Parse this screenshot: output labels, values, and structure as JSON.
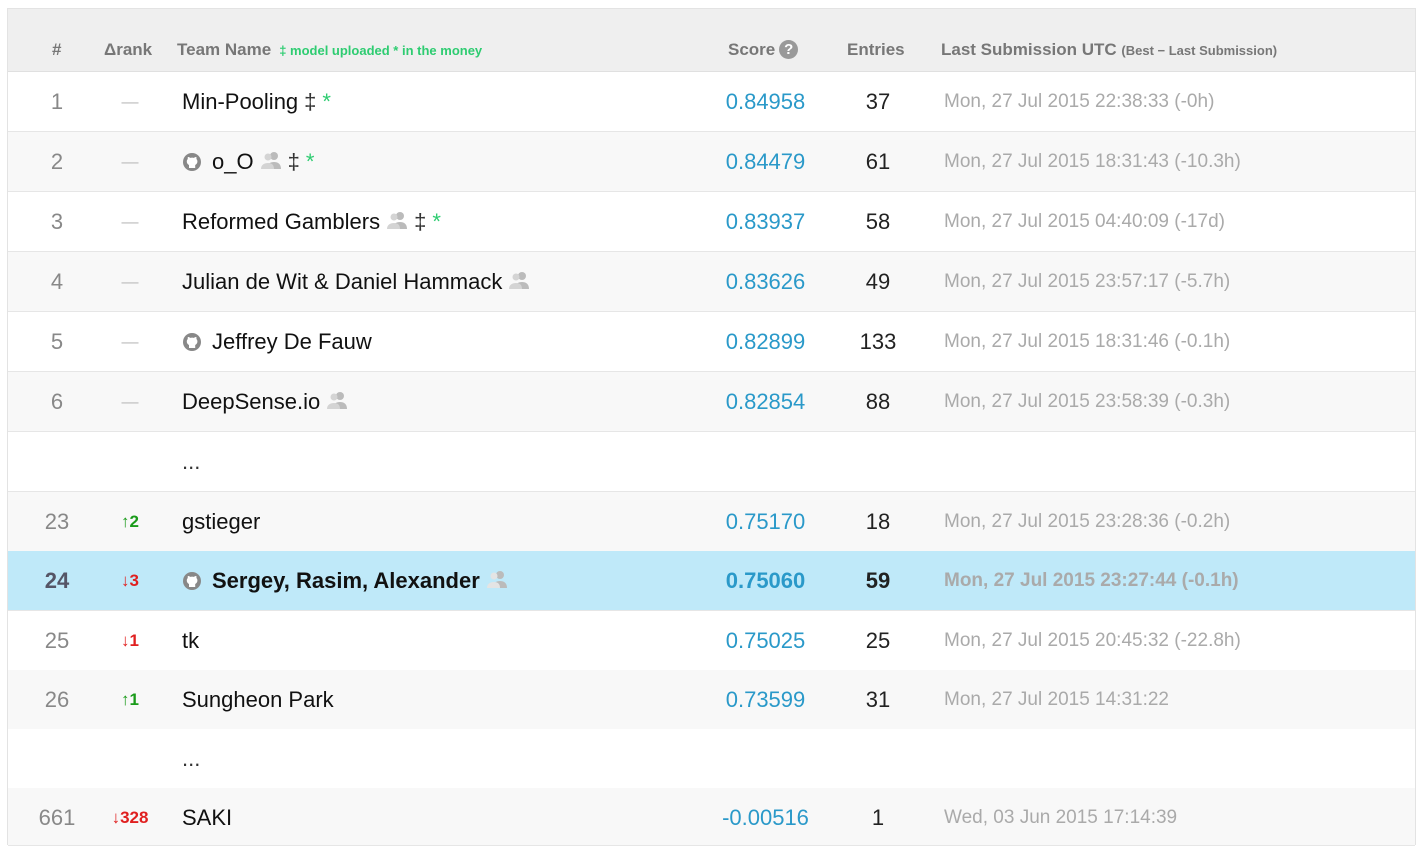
{
  "header": {
    "rank": "#",
    "delta": "Δrank",
    "team": "Team Name",
    "legend": "‡ model uploaded * in the money",
    "score": "Score",
    "help_glyph": "?",
    "entries": "Entries",
    "last": "Last Submission UTC",
    "last_note": "(Best − Last Submission)"
  },
  "rows": [
    {
      "rank": "1",
      "delta": "—",
      "team": "Min-Pooling",
      "score": "0.84958",
      "entries": "37",
      "last": "Mon, 27 Jul 2015 22:38:33 (-0h)"
    },
    {
      "rank": "2",
      "delta": "—",
      "team": "o_O",
      "score": "0.84479",
      "entries": "61",
      "last": "Mon, 27 Jul 2015 18:31:43 (-10.3h)"
    },
    {
      "rank": "3",
      "delta": "—",
      "team": "Reformed Gamblers",
      "score": "0.83937",
      "entries": "58",
      "last": "Mon, 27 Jul 2015 04:40:09 (-17d)"
    },
    {
      "rank": "4",
      "delta": "—",
      "team": "Julian de Wit & Daniel Hammack",
      "score": "0.83626",
      "entries": "49",
      "last": "Mon, 27 Jul 2015 23:57:17 (-5.7h)"
    },
    {
      "rank": "5",
      "delta": "—",
      "team": "Jeffrey De Fauw",
      "score": "0.82899",
      "entries": "133",
      "last": "Mon, 27 Jul 2015 18:31:46 (-0.1h)"
    },
    {
      "rank": "6",
      "delta": "—",
      "team": "DeepSense.io",
      "score": "0.82854",
      "entries": "88",
      "last": "Mon, 27 Jul 2015 23:58:39 (-0.3h)"
    },
    {
      "ellipsis": "..."
    },
    {
      "rank": "23",
      "delta": "↑2",
      "team": "gstieger",
      "score": "0.75170",
      "entries": "18",
      "last": "Mon, 27 Jul 2015 23:28:36 (-0.2h)"
    },
    {
      "rank": "24",
      "delta": "↓3",
      "team": "Sergey, Rasim, Alexander",
      "score": "0.75060",
      "entries": "59",
      "last": "Mon, 27 Jul 2015 23:27:44 (-0.1h)"
    },
    {
      "rank": "25",
      "delta": "↓1",
      "team": "tk",
      "score": "0.75025",
      "entries": "25",
      "last": "Mon, 27 Jul 2015 20:45:32 (-22.8h)"
    },
    {
      "rank": "26",
      "delta": "↑1",
      "team": "Sungheon Park",
      "score": "0.73599",
      "entries": "31",
      "last": "Mon, 27 Jul 2015 14:31:22"
    },
    {
      "ellipsis": "..."
    },
    {
      "rank": "661",
      "delta": "↓328",
      "team": "SAKI",
      "score": "-0.00516",
      "entries": "1",
      "last": "Wed, 03 Jun 2015 17:14:39"
    }
  ],
  "marks": {
    "dagger": "‡",
    "star": "*"
  },
  "colors": {
    "score": "#2a99c9",
    "highlight_row": "#bfe9f9",
    "rank_up": "#1a9b1a",
    "rank_down": "#e02020",
    "legend": "#2ecc71"
  }
}
